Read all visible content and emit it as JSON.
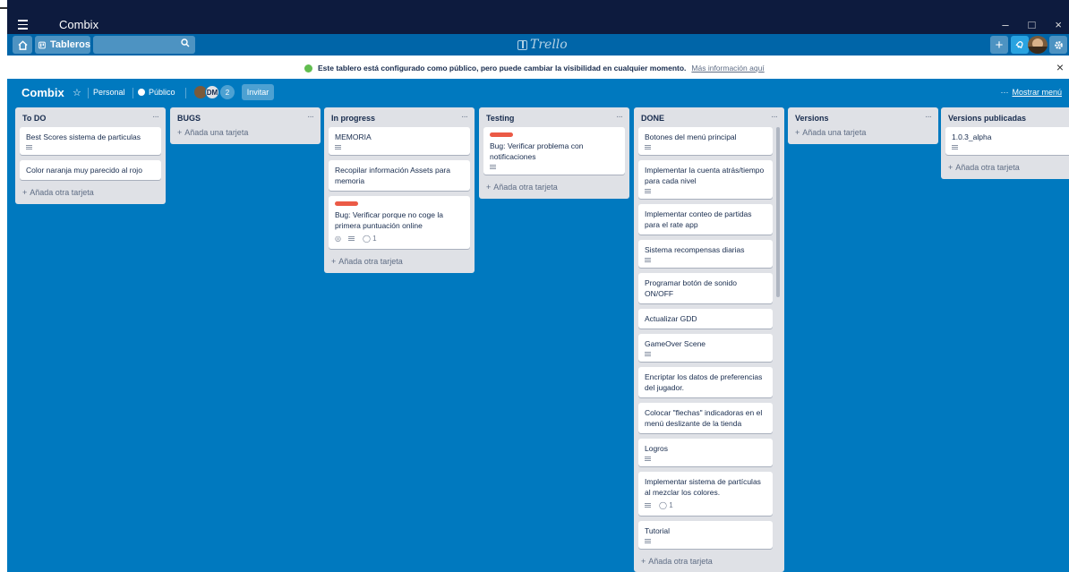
{
  "window": {
    "title": "Combix",
    "minimize": "–",
    "maximize": "□",
    "close": "×"
  },
  "header": {
    "boards_label": "Tableros",
    "search_value": "",
    "logo_text": "Trello",
    "add_symbol": "+"
  },
  "banner": {
    "message": "Este tablero está configurado como público, pero puede cambiar la visibilidad en cualquier momento.",
    "link": "Más información aquí",
    "close": "×"
  },
  "board": {
    "name": "Combix",
    "team": "Personal",
    "visibility": "Público",
    "member_initials": "DM",
    "member_count": "2",
    "invite": "Invitar",
    "menu_dots": "···",
    "show_menu": "Mostrar menú"
  },
  "lists": [
    {
      "title": "To DO",
      "cards": [
        {
          "text": "Best Scores sistema de particulas",
          "desc": true
        },
        {
          "text": "Color naranja muy parecido al rojo"
        }
      ],
      "add_label": "Añada otra tarjeta"
    },
    {
      "title": "BUGS",
      "cards": [],
      "add_label": "Añada una tarjeta"
    },
    {
      "title": "In progress",
      "cards": [
        {
          "text": "MEMORIA",
          "desc": true
        },
        {
          "text": "Recopilar información Assets para memoria"
        },
        {
          "text": "Bug: Verificar porque no coge la primera puntuación online",
          "label": "red",
          "watch": true,
          "desc": true,
          "comments": "1"
        }
      ],
      "add_label": "Añada otra tarjeta"
    },
    {
      "title": "Testing",
      "cards": [
        {
          "text": "Bug: Verificar problema con notificaciones",
          "label": "red",
          "desc": true
        }
      ],
      "add_label": "Añada otra tarjeta"
    },
    {
      "title": "DONE",
      "cards": [
        {
          "text": "Botones del menú principal",
          "desc": true
        },
        {
          "text": "Implementar la cuenta atrás/tiempo para cada nivel",
          "desc": true
        },
        {
          "text": "Implementar conteo de partidas para el rate app"
        },
        {
          "text": "Sistema recompensas diarias",
          "desc": true
        },
        {
          "text": "Programar botón de sonido ON/OFF"
        },
        {
          "text": "Actualizar GDD"
        },
        {
          "text": "GameOver Scene",
          "desc": true
        },
        {
          "text": "Encriptar los datos de preferencias del jugador."
        },
        {
          "text": "Colocar \"flechas\" indicadoras en el menú deslizante de la tienda"
        },
        {
          "text": "Logros",
          "desc": true
        },
        {
          "text": "Implementar sistema de partículas al mezclar los colores.",
          "desc": true,
          "comments": "1"
        },
        {
          "text": "Tutorial",
          "desc": true
        }
      ],
      "add_label": "Añada otra tarjeta"
    },
    {
      "title": "Versions",
      "cards": [],
      "add_label": "Añada una tarjeta"
    },
    {
      "title": "Versions publicadas",
      "cards": [
        {
          "text": "1.0.3_alpha",
          "desc": true
        }
      ],
      "add_label": "Añada otra tarjeta"
    }
  ],
  "colors": {
    "board_bg": "#0079bf",
    "list_bg": "#dfe1e6",
    "label_red": "#eb5a46"
  }
}
